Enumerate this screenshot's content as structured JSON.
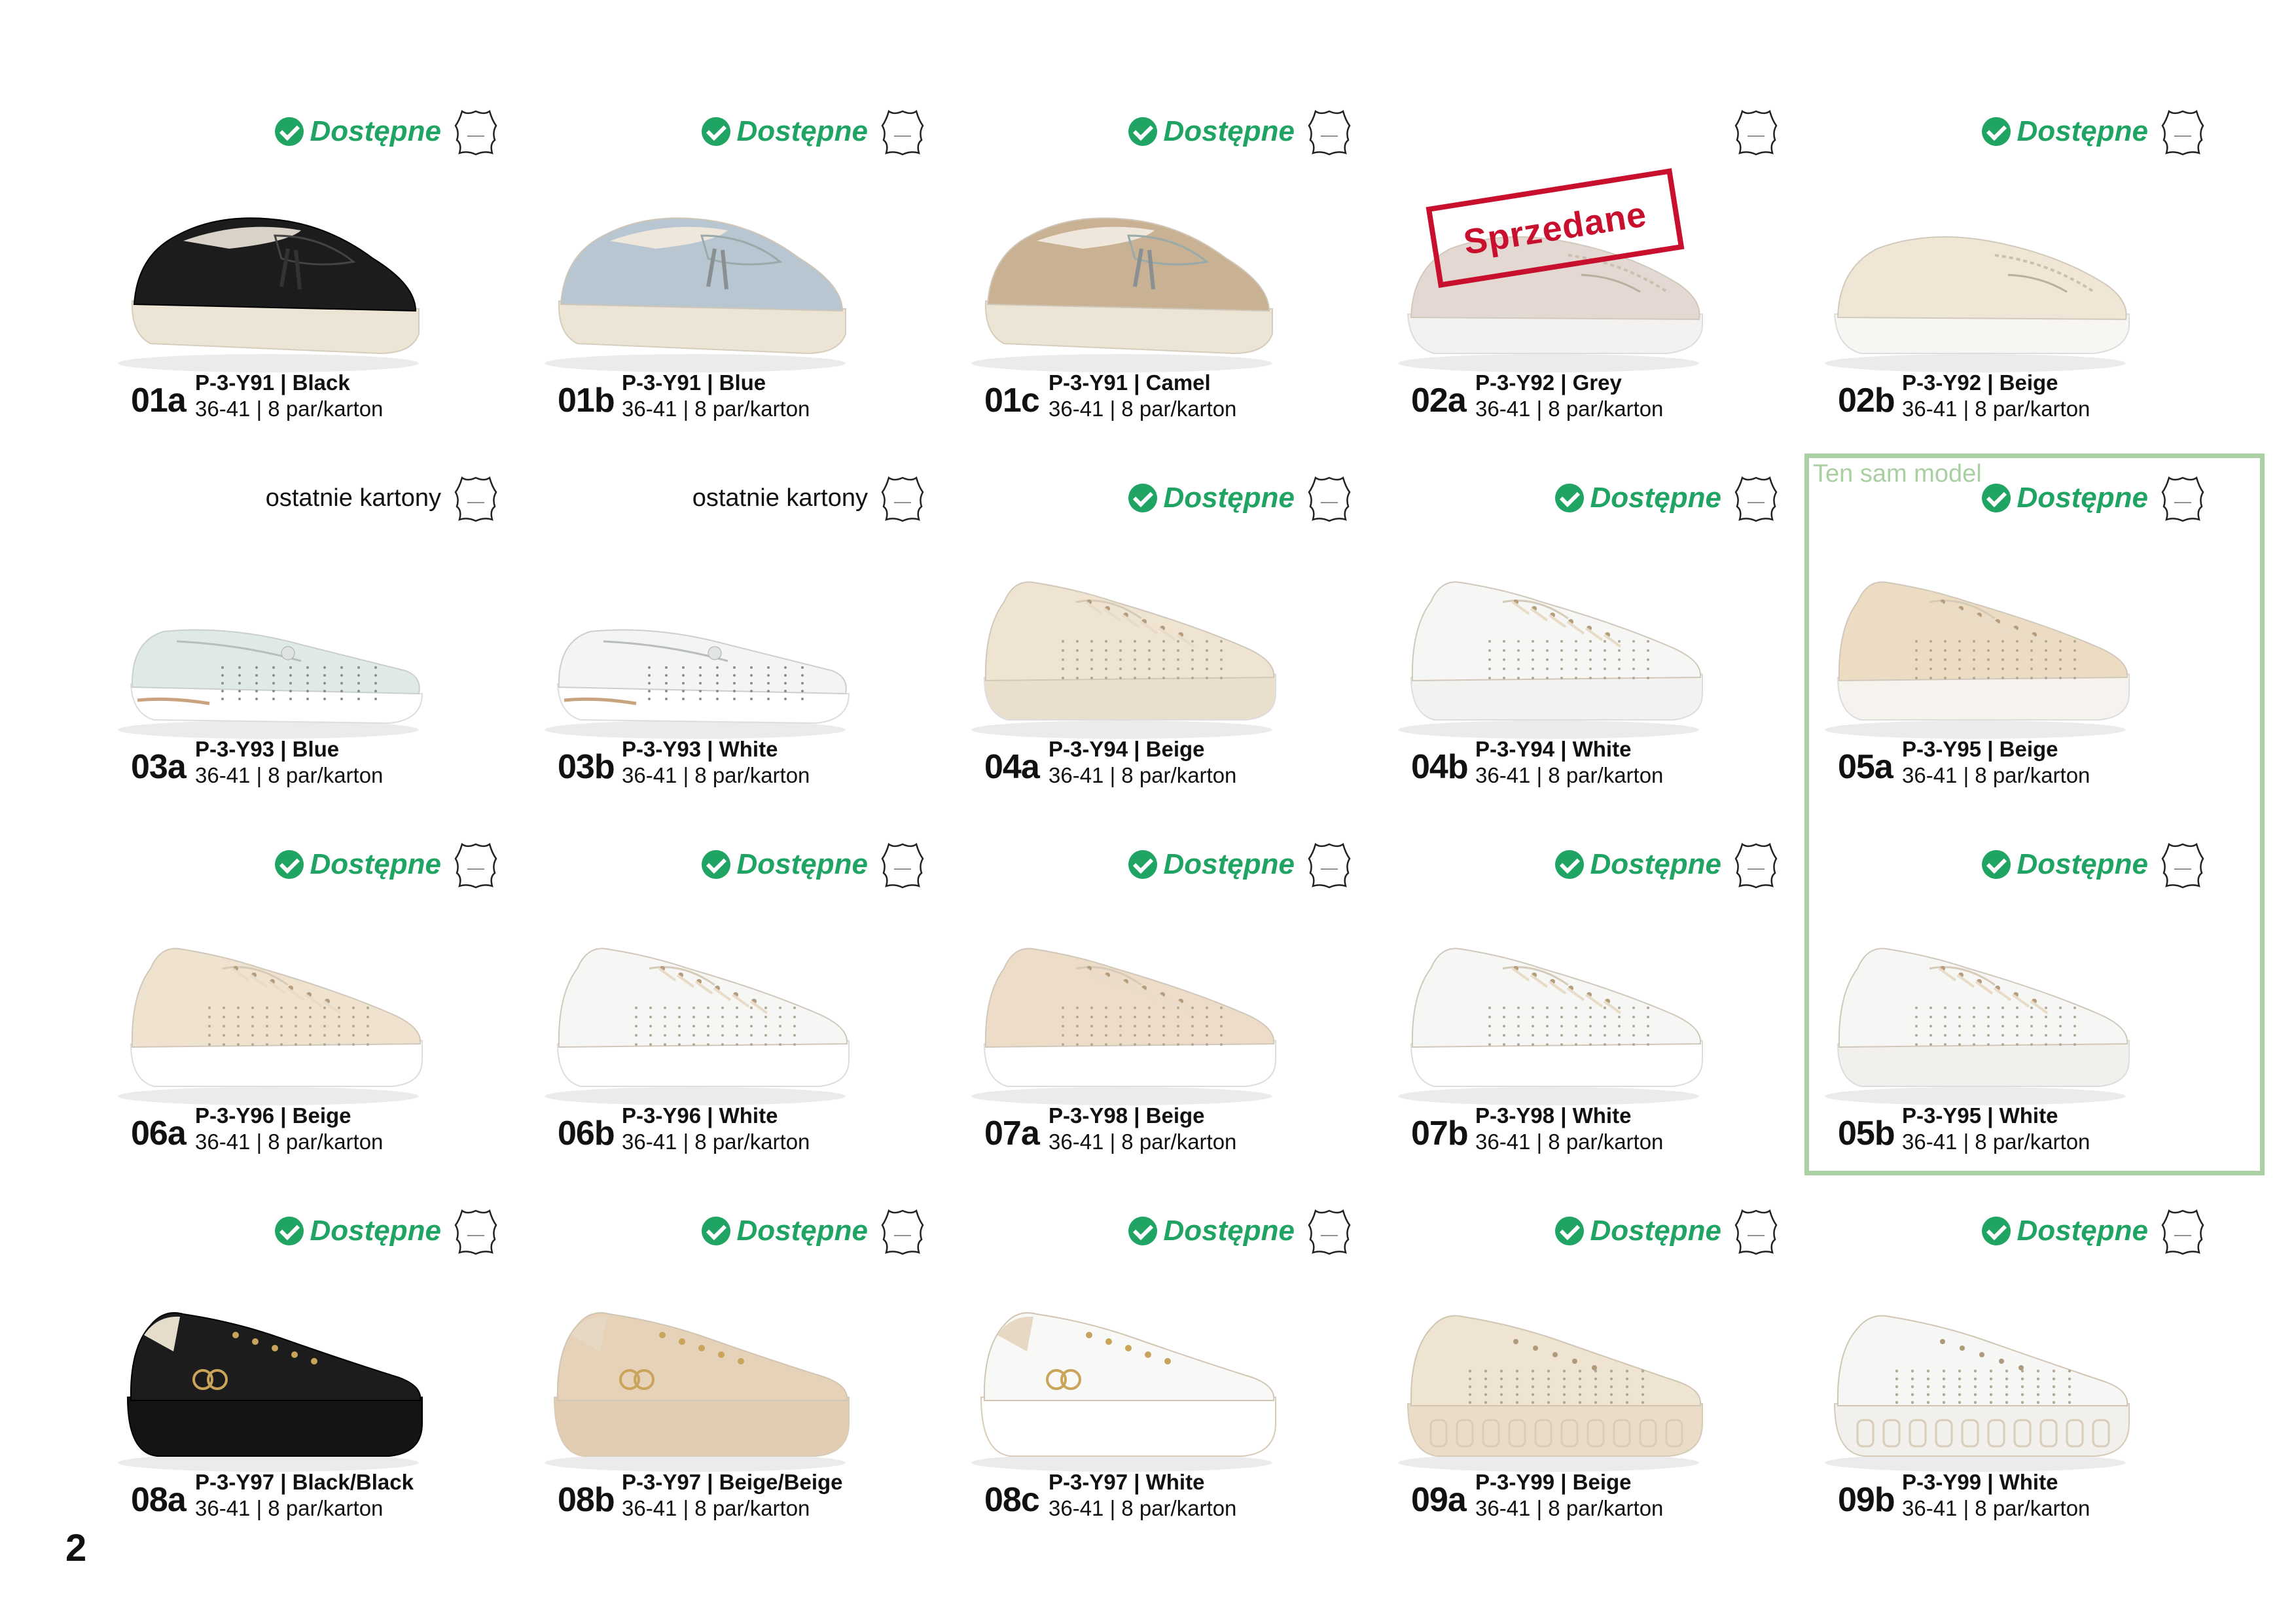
{
  "page_number": "2",
  "highlight_label": "Ten sam model",
  "sold_stamp": "Sprzedane",
  "colors": {
    "available": "#1fa463",
    "sold": "#c8102e",
    "frame": "#a9cfa3"
  },
  "cards": [
    {
      "code": "01a",
      "model": "P-3-Y91 | Black",
      "sizes": "36-41 | 8 par/karton",
      "status": "Dostępne",
      "shoe": "loafer",
      "palette": {
        "upper": "#1c1c1c",
        "sole": "#ece4d4"
      }
    },
    {
      "code": "01b",
      "model": "P-3-Y91 | Blue",
      "sizes": "36-41 | 8 par/karton",
      "status": "Dostępne",
      "shoe": "loafer",
      "palette": {
        "upper": "#b8c6d2",
        "sole": "#ece4d4"
      }
    },
    {
      "code": "01c",
      "model": "P-3-Y91 | Camel",
      "sizes": "36-41 | 8 par/karton",
      "status": "Dostępne",
      "shoe": "loafer",
      "palette": {
        "upper": "#c9b194",
        "sole": "#ece4d4"
      }
    },
    {
      "code": "02a",
      "model": "P-3-Y92 | Grey",
      "sizes": "36-41 | 8 par/karton",
      "status": "",
      "shoe": "moccasin",
      "palette": {
        "upper": "#e4d8d2",
        "sole": "#f4f2f0"
      }
    },
    {
      "code": "02b",
      "model": "P-3-Y92 | Beige",
      "sizes": "36-41 | 8 par/karton",
      "status": "Dostępne",
      "shoe": "moccasin",
      "palette": {
        "upper": "#efe6d6",
        "sole": "#f8f6f2"
      }
    },
    {
      "code": "03a",
      "model": "P-3-Y93 | Blue",
      "sizes": "36-41 | 8 par/karton",
      "status": "ostatnie kartony",
      "shoe": "ballet",
      "palette": {
        "upper": "#dfe9e6",
        "sole": "#ffffff"
      }
    },
    {
      "code": "03b",
      "model": "P-3-Y93 | White",
      "sizes": "36-41 | 8 par/karton",
      "status": "ostatnie kartony",
      "shoe": "ballet",
      "palette": {
        "upper": "#f4f4f2",
        "sole": "#ffffff"
      }
    },
    {
      "code": "04a",
      "model": "P-3-Y94 | Beige",
      "sizes": "36-41 | 8 par/karton",
      "status": "Dostępne",
      "shoe": "sneaker",
      "palette": {
        "upper": "#efe3d1",
        "sole": "#eadfcc"
      }
    },
    {
      "code": "04b",
      "model": "P-3-Y94 | White",
      "sizes": "36-41 | 8 par/karton",
      "status": "Dostępne",
      "shoe": "sneaker",
      "palette": {
        "upper": "#f6f6f4",
        "sole": "#f2f2f0"
      }
    },
    {
      "code": "05a",
      "model": "P-3-Y95 | Beige",
      "sizes": "36-41 | 8 par/karton",
      "status": "Dostępne",
      "shoe": "sneaker",
      "palette": {
        "upper": "#ecdcc4",
        "sole": "#f6f3ee"
      }
    },
    {
      "code": "06a",
      "model": "P-3-Y96 | Beige",
      "sizes": "36-41 | 8 par/karton",
      "status": "Dostępne",
      "shoe": "sneaker",
      "palette": {
        "upper": "#efe2cf",
        "sole": "#ffffff"
      }
    },
    {
      "code": "06b",
      "model": "P-3-Y96 | White",
      "sizes": "36-41 | 8 par/karton",
      "status": "Dostępne",
      "shoe": "sneaker",
      "palette": {
        "upper": "#f6f6f4",
        "sole": "#ffffff"
      }
    },
    {
      "code": "07a",
      "model": "P-3-Y98 | Beige",
      "sizes": "36-41 | 8 par/karton",
      "status": "Dostępne",
      "shoe": "sneaker",
      "palette": {
        "upper": "#ecdcc8",
        "sole": "#ffffff"
      }
    },
    {
      "code": "07b",
      "model": "P-3-Y98 | White",
      "sizes": "36-41 | 8 par/karton",
      "status": "Dostępne",
      "shoe": "sneaker",
      "palette": {
        "upper": "#f6f6f4",
        "sole": "#ffffff"
      }
    },
    {
      "code": "05b",
      "model": "P-3-Y95 | White",
      "sizes": "36-41 | 8 par/karton",
      "status": "Dostępne",
      "shoe": "sneaker",
      "palette": {
        "upper": "#f6f6f4",
        "sole": "#f2f0ec"
      }
    },
    {
      "code": "08a",
      "model": "P-3-Y97 | Black/Black",
      "sizes": "36-41 | 8 par/karton",
      "status": "Dostępne",
      "shoe": "platform",
      "palette": {
        "upper": "#1c1c1c",
        "sole": "#141414"
      }
    },
    {
      "code": "08b",
      "model": "P-3-Y97 | Beige/Beige",
      "sizes": "36-41 | 8 par/karton",
      "status": "Dostępne",
      "shoe": "platform",
      "palette": {
        "upper": "#e6d2b8",
        "sole": "#e2cdb2"
      }
    },
    {
      "code": "08c",
      "model": "P-3-Y97 | White",
      "sizes": "36-41 | 8 par/karton",
      "status": "Dostępne",
      "shoe": "platform",
      "palette": {
        "upper": "#f8f8f6",
        "sole": "#ffffff"
      }
    },
    {
      "code": "09a",
      "model": "P-3-Y99 | Beige",
      "sizes": "36-41 | 8 par/karton",
      "status": "Dostępne",
      "shoe": "chunky",
      "palette": {
        "upper": "#efe3d1",
        "sole": "#eadcc6"
      }
    },
    {
      "code": "09b",
      "model": "P-3-Y99 | White",
      "sizes": "36-41 | 8 par/karton",
      "status": "Dostępne",
      "shoe": "chunky",
      "palette": {
        "upper": "#f6f6f4",
        "sole": "#f2f0ec"
      }
    }
  ]
}
